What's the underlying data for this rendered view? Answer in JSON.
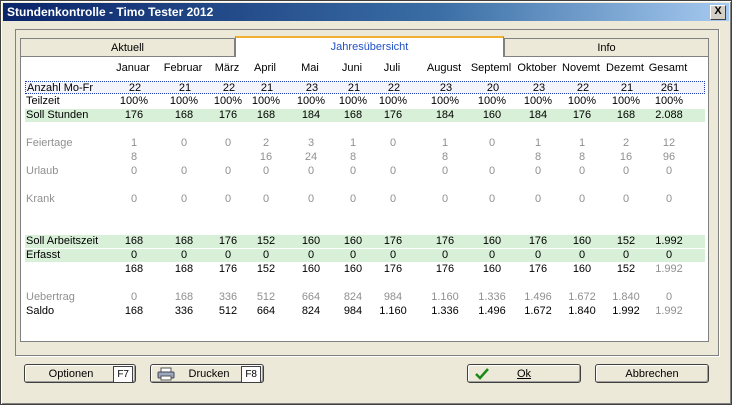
{
  "window": {
    "title": "Stundenkontrolle - Timo Tester 2012",
    "close_glyph": "X"
  },
  "tabs": [
    {
      "label": "Aktuell",
      "active": false
    },
    {
      "label": "Jahresübersicht",
      "active": true
    },
    {
      "label": "Info",
      "active": false
    }
  ],
  "columns": [
    "Januar",
    "Februar",
    "März",
    "April",
    "Mai",
    "Juni",
    "Juli",
    "August",
    "Septeml",
    "Oktober",
    "Novemt",
    "Dezemt",
    "Gesamt"
  ],
  "rows": [
    {
      "label": "Anzahl Mo-Fr",
      "style": "sel",
      "values": [
        "22",
        "21",
        "22",
        "21",
        "23",
        "21",
        "22",
        "23",
        "20",
        "23",
        "22",
        "21",
        "261"
      ]
    },
    {
      "label": "Teilzeit",
      "style": "",
      "values": [
        "100%",
        "100%",
        "100%",
        "100%",
        "100%",
        "100%",
        "100%",
        "100%",
        "100%",
        "100%",
        "100%",
        "100%",
        "100%"
      ]
    },
    {
      "label": "Soll Stunden",
      "style": "green",
      "values": [
        "176",
        "168",
        "176",
        "168",
        "184",
        "168",
        "176",
        "184",
        "160",
        "184",
        "176",
        "168",
        "2.088"
      ]
    },
    {
      "label": "Feiertage",
      "style": "gray",
      "values": [
        "1",
        "0",
        "0",
        "2",
        "3",
        "1",
        "0",
        "1",
        "0",
        "1",
        "1",
        "2",
        "12"
      ]
    },
    {
      "label": "",
      "style": "gray",
      "values": [
        "8",
        "",
        "",
        "16",
        "24",
        "8",
        "",
        "8",
        "",
        "8",
        "8",
        "16",
        "96"
      ]
    },
    {
      "label": "Urlaub",
      "style": "gray",
      "values": [
        "0",
        "0",
        "0",
        "0",
        "0",
        "0",
        "0",
        "0",
        "0",
        "0",
        "0",
        "0",
        "0"
      ]
    },
    {
      "label": "Krank",
      "style": "gray",
      "values": [
        "0",
        "0",
        "0",
        "0",
        "0",
        "0",
        "0",
        "0",
        "0",
        "0",
        "0",
        "0",
        "0"
      ]
    },
    {
      "label": "Soll Arbeitszeit",
      "style": "green",
      "values": [
        "168",
        "168",
        "176",
        "152",
        "160",
        "160",
        "176",
        "176",
        "160",
        "176",
        "160",
        "152",
        "1.992"
      ]
    },
    {
      "label": "Erfasst",
      "style": "green",
      "values": [
        "0",
        "0",
        "0",
        "0",
        "0",
        "0",
        "0",
        "0",
        "0",
        "0",
        "0",
        "0",
        "0"
      ]
    },
    {
      "label": "",
      "style": "",
      "values": [
        "168",
        "168",
        "176",
        "152",
        "160",
        "160",
        "176",
        "176",
        "160",
        "176",
        "160",
        "152",
        "1.992"
      ],
      "last_gray": true
    },
    {
      "label": "Uebertrag",
      "style": "gray",
      "values": [
        "0",
        "168",
        "336",
        "512",
        "664",
        "824",
        "984",
        "1.160",
        "1.336",
        "1.496",
        "1.672",
        "1.840",
        "0"
      ]
    },
    {
      "label": "Saldo",
      "style": "",
      "values": [
        "168",
        "336",
        "512",
        "664",
        "824",
        "984",
        "1.160",
        "1.336",
        "1.496",
        "1.672",
        "1.840",
        "1.992",
        "1.992"
      ],
      "last_gray": true
    }
  ],
  "buttons": {
    "optionen": {
      "label": "Optionen",
      "key": "F7"
    },
    "drucken": {
      "label": "Drucken",
      "key": "F8"
    },
    "ok": {
      "label": "Ok"
    },
    "abbrechen": {
      "label": "Abbrechen"
    }
  },
  "icons": {
    "ok": "checkmark-icon",
    "drucken": "printer-icon"
  }
}
